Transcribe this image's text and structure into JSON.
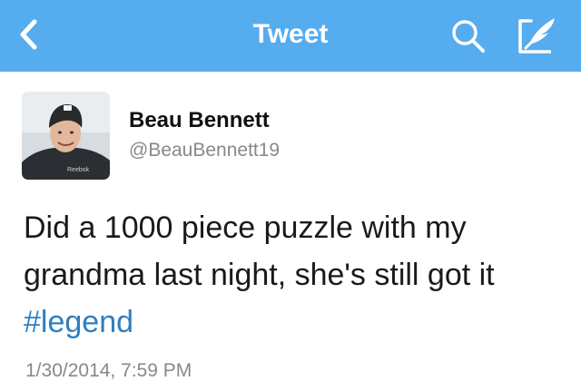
{
  "navbar": {
    "title": "Tweet",
    "back_icon": "chevron-left-icon",
    "search_icon": "search-icon",
    "compose_icon": "compose-tweet-icon",
    "background_color": "#55acee"
  },
  "tweet": {
    "author": {
      "display_name": "Beau Bennett",
      "screen_name": "@BeauBennett19",
      "avatar": "profile-photo"
    },
    "text_parts": [
      "Did a 1000 piece puzzle with my grandma last night, she's still got it ",
      "#legend"
    ],
    "hashtag_color": "#2f7fbf",
    "timestamp": "1/30/2014, 7:59 PM"
  }
}
